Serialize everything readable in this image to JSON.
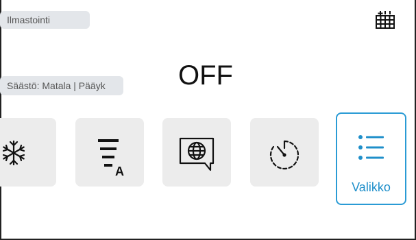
{
  "header": {
    "mode_label": "Ilmastointi",
    "schedule_icon": "calendar-grid-icon"
  },
  "info": {
    "eco_label": "Säästö: Matala | Pääyk"
  },
  "status": {
    "power_state": "OFF"
  },
  "tiles": [
    {
      "icon": "snowflake-icon"
    },
    {
      "icon": "fan-speed-auto-icon"
    },
    {
      "icon": "language-globe-icon"
    },
    {
      "icon": "timer-icon"
    },
    {
      "icon": "menu-list-icon",
      "label": "Valikko"
    }
  ],
  "colors": {
    "accent": "#2a9bd5",
    "tile_bg": "#ececec",
    "pill_bg": "#e3e6ea"
  }
}
